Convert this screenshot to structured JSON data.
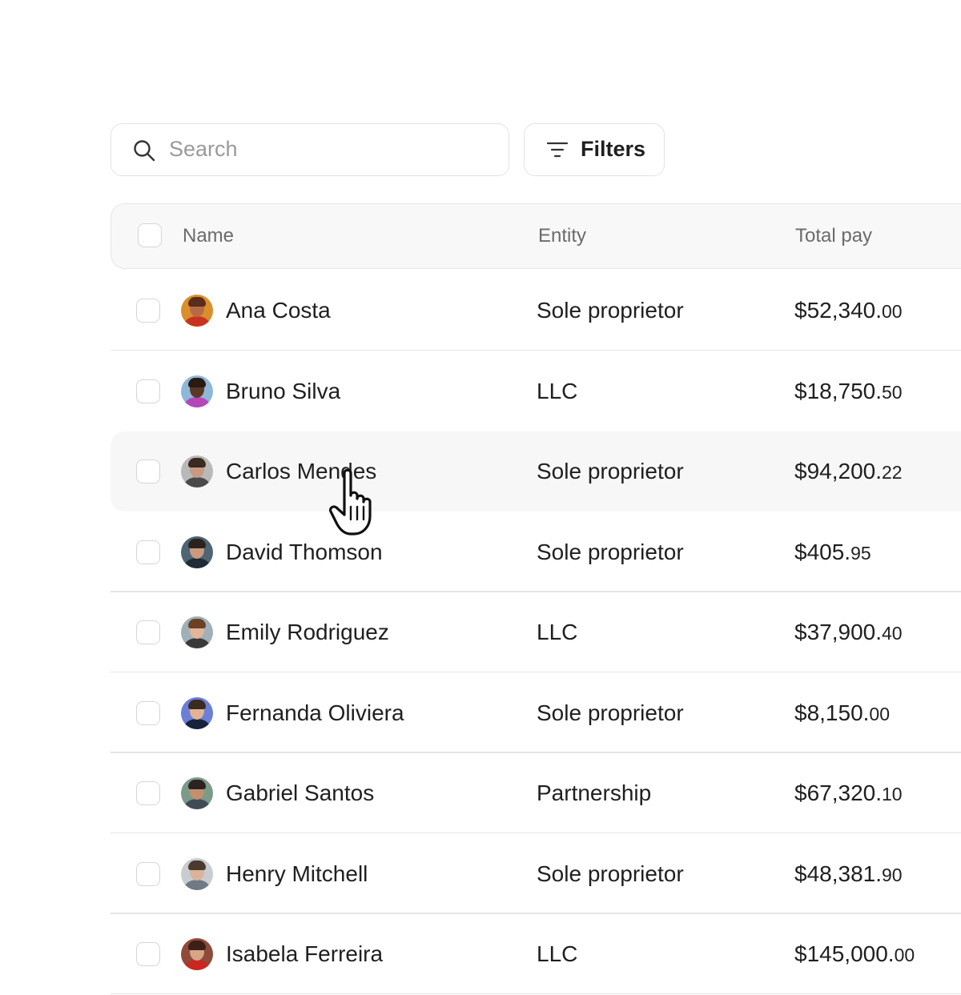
{
  "search": {
    "placeholder": "Search",
    "icon": "search-icon"
  },
  "filters": {
    "label": "Filters",
    "icon": "filter-icon"
  },
  "table": {
    "columns": [
      "Name",
      "Entity",
      "Total pay"
    ],
    "rows": [
      {
        "name": "Ana Costa",
        "entity": "Sole proprietor",
        "pay_main": "$52,340.",
        "pay_cents": "00",
        "avatar": {
          "bg": "#d9902c",
          "skin": "#b86a45",
          "hair": "#5a2c1a",
          "shirt": "#c8331f"
        }
      },
      {
        "name": "Bruno Silva",
        "entity": "LLC",
        "pay_main": "$18,750.",
        "pay_cents": "50",
        "avatar": {
          "bg": "#8fb7d8",
          "skin": "#5a3826",
          "hair": "#2a1a12",
          "shirt": "#b548b9"
        }
      },
      {
        "name": "Carlos Mendes",
        "entity": "Sole proprietor",
        "pay_main": "$94,200.",
        "pay_cents": "22",
        "avatar": {
          "bg": "#b9b9b9",
          "skin": "#c79a82",
          "hair": "#3a2a20",
          "shirt": "#4a4a4a"
        }
      },
      {
        "name": "David Thomson",
        "entity": "Sole proprietor",
        "pay_main": "$405.",
        "pay_cents": "95",
        "avatar": {
          "bg": "#4f6474",
          "skin": "#c99a7e",
          "hair": "#2b231e",
          "shirt": "#1f2b36"
        }
      },
      {
        "name": "Emily Rodriguez",
        "entity": "LLC",
        "pay_main": "$37,900.",
        "pay_cents": "40",
        "avatar": {
          "bg": "#9fb0b8",
          "skin": "#e2b59a",
          "hair": "#6b4025",
          "shirt": "#3a3a3a"
        }
      },
      {
        "name": "Fernanda Oliviera",
        "entity": "Sole proprietor",
        "pay_main": "$8,150.",
        "pay_cents": "00",
        "avatar": {
          "bg": "#6c7fd6",
          "skin": "#e0b494",
          "hair": "#3a2b22",
          "shirt": "#16233a"
        }
      },
      {
        "name": "Gabriel Santos",
        "entity": "Partnership",
        "pay_main": "$67,320.",
        "pay_cents": "10",
        "avatar": {
          "bg": "#7c9a8a",
          "skin": "#c3906f",
          "hair": "#2c2320",
          "shirt": "#3f4c56"
        }
      },
      {
        "name": "Henry Mitchell",
        "entity": "Sole proprietor",
        "pay_main": "$48,381.",
        "pay_cents": "90",
        "avatar": {
          "bg": "#c9ccd1",
          "skin": "#dbb39b",
          "hair": "#4a3a30",
          "shirt": "#6f7a84"
        }
      },
      {
        "name": "Isabela Ferreira",
        "entity": "LLC",
        "pay_main": "$145,000.",
        "pay_cents": "00",
        "avatar": {
          "bg": "#8e4a3a",
          "skin": "#d7a585",
          "hair": "#3c1f17",
          "shirt": "#c8281f"
        }
      }
    ]
  },
  "colors": {
    "border": "#e3e3e3",
    "header_bg": "#f8f8f8",
    "hover_bg": "#f7f7f7",
    "text": "#1f1f1f",
    "muted": "#6b6b6b",
    "placeholder": "#9a9a9a"
  },
  "cursor": {
    "icon": "hand-pointer-cursor-icon",
    "hovered_row": 2
  }
}
